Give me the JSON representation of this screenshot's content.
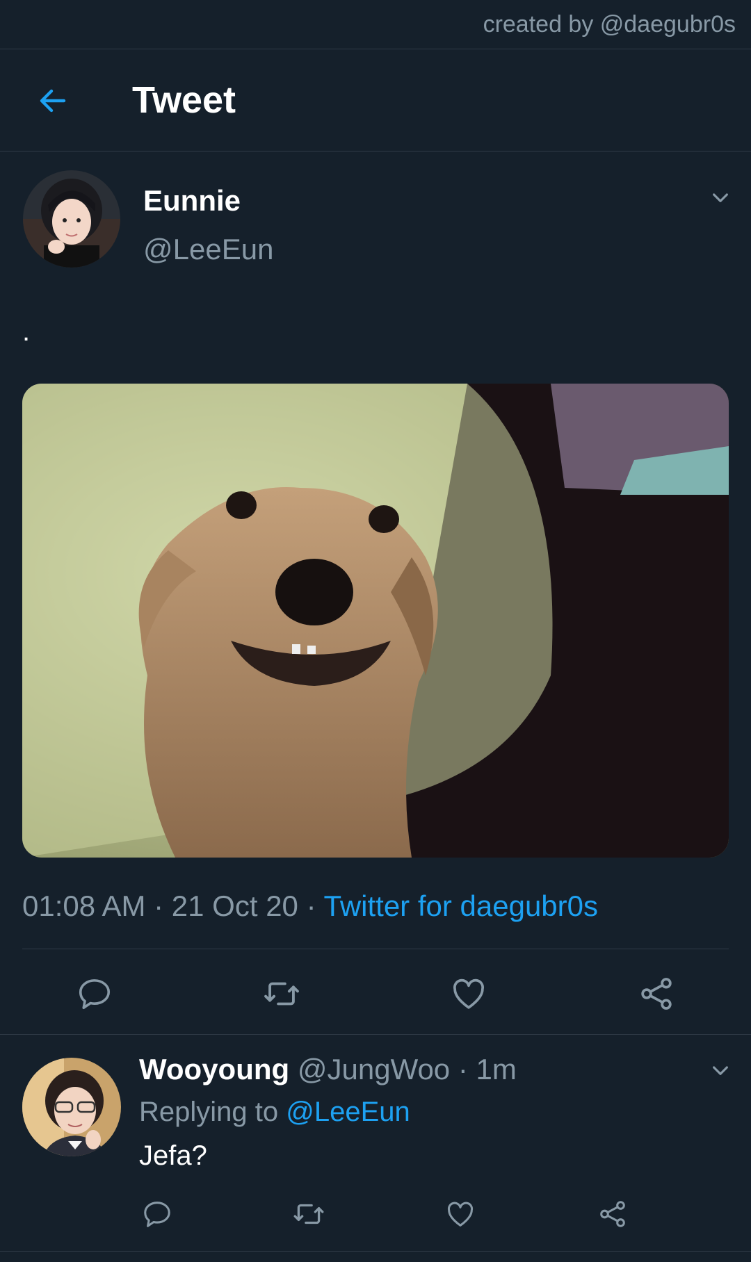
{
  "credit": "created by @daegubr0s",
  "header": {
    "title": "Tweet"
  },
  "tweet": {
    "name": "Eunnie",
    "handle": "@LeeEun",
    "text": ".",
    "time": "01:08 AM",
    "date": "21 Oct 20",
    "source": "Twitter for daegubr0s"
  },
  "reply": {
    "name": "Wooyoung",
    "handle": "@JungWoo",
    "time": "1m",
    "replying_label": "Replying to",
    "replying_handle": "@LeeEun",
    "text": "Jefa?"
  },
  "colors": {
    "background": "#15202b",
    "accent": "#1da1f2",
    "muted": "#8899a6",
    "divider": "#2f3b47"
  },
  "icons": [
    "back-arrow-icon",
    "chevron-down-icon",
    "reply-icon",
    "retweet-icon",
    "like-icon",
    "share-icon"
  ]
}
